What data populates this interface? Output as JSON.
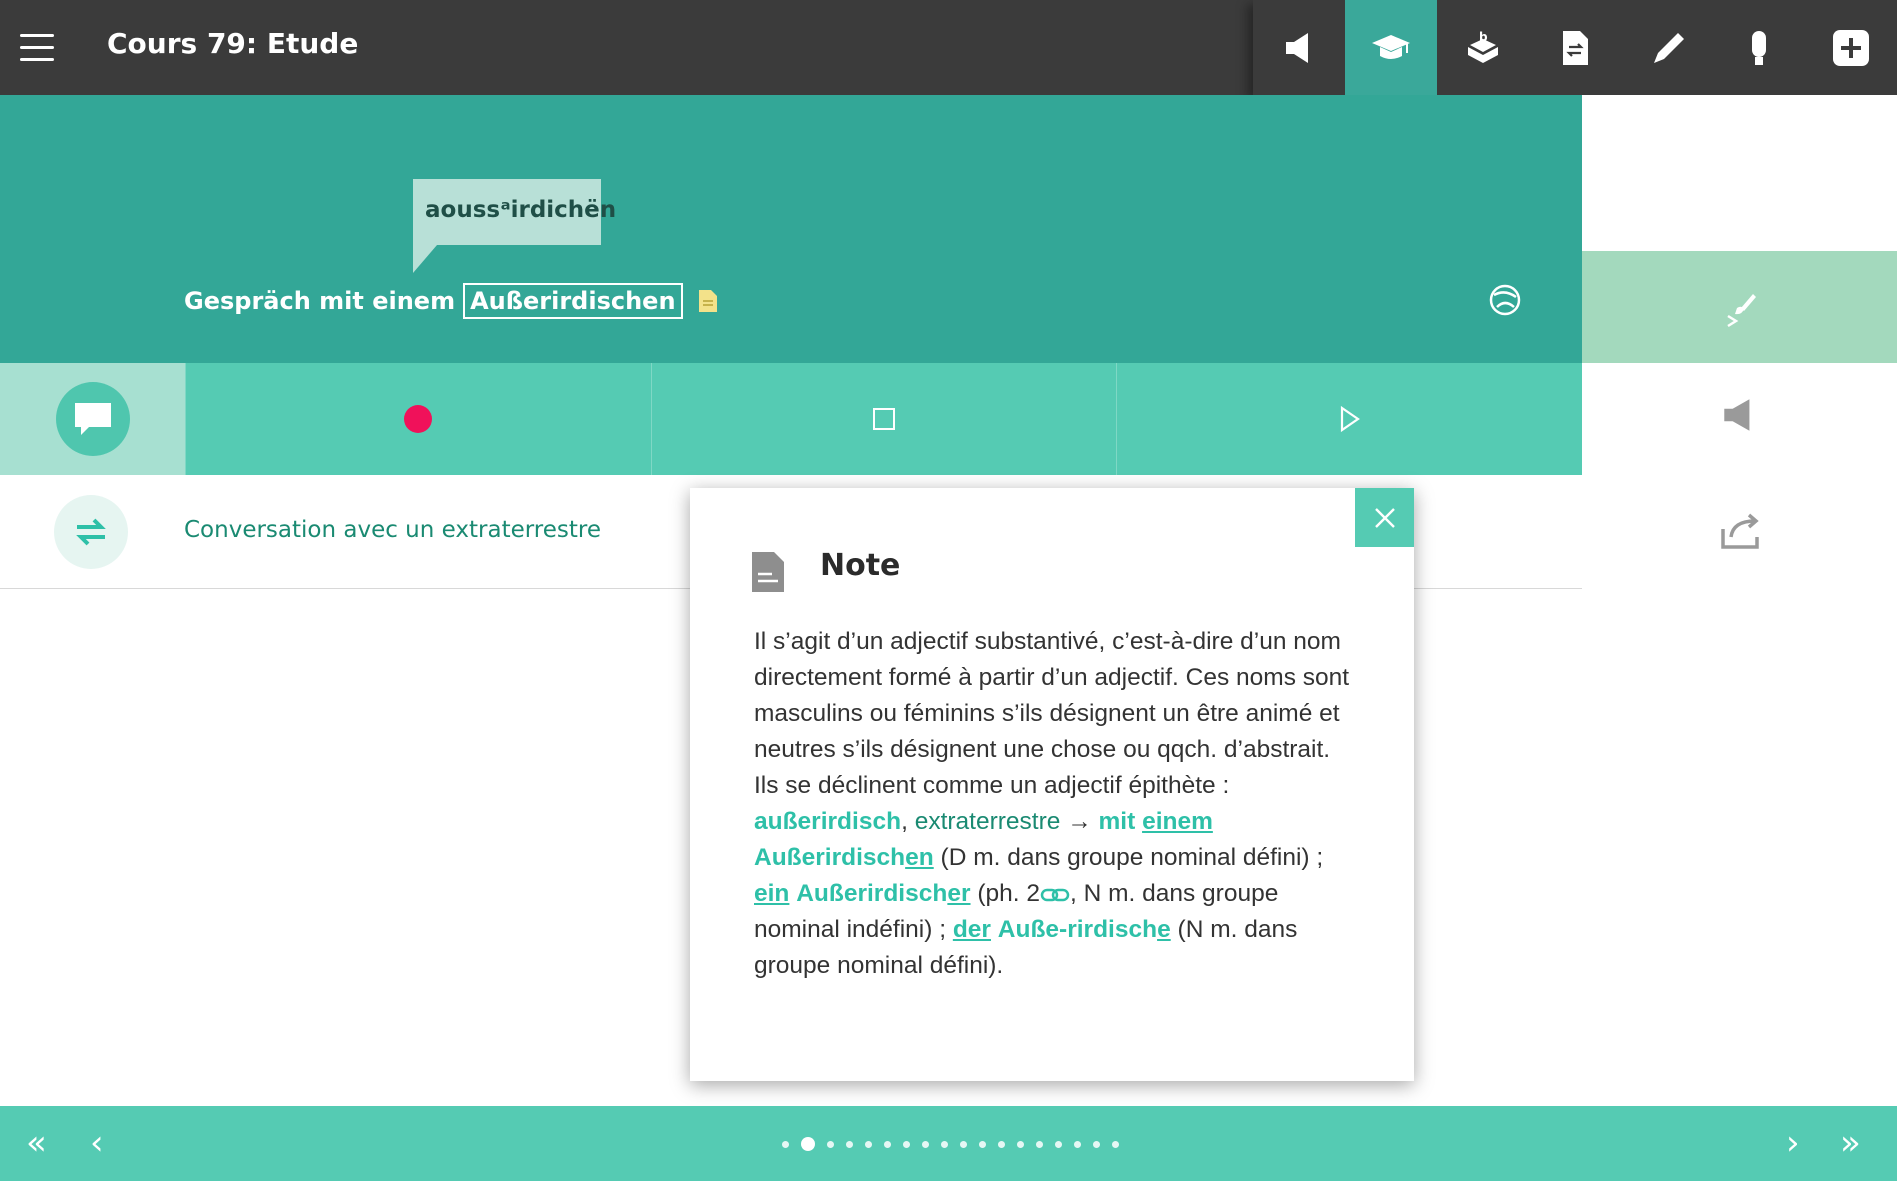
{
  "app": {
    "title": "Cours 79: Etude"
  },
  "toolbar": {
    "buttons": [
      {
        "name": "speaker-icon",
        "active": false
      },
      {
        "name": "graduation-cap-icon",
        "active": true
      },
      {
        "name": "exercise-box-icon",
        "active": false
      },
      {
        "name": "document-translate-icon",
        "active": false
      },
      {
        "name": "pen-icon",
        "active": false
      },
      {
        "name": "microphone-icon",
        "active": false
      },
      {
        "name": "plus-icon",
        "active": false
      }
    ]
  },
  "lesson": {
    "tooltip_phonetic": "aoussᵃirdichën",
    "sentence_prefix": "Gespräch mit einem",
    "sentence_word": "Außerirdischen",
    "translation": "Conversation avec un extraterrestre"
  },
  "note": {
    "title": "Note",
    "p1": "Il s’agit d’un adjectif substantivé, c’est-à-dire d’un nom directement formé à partir d’un adjectif. Ces noms sont masculins ou féminins s’ils désignent un être animé et neutres s’ils désignent une chose ou qqch. d’abstrait. Ils se déclinent comme un adjectif épithète :",
    "w_ausserirdisch": "außerirdisch",
    "comma1": ",",
    "fr_extraterrestre": "extraterrestre",
    "arrow": "→",
    "w_mit": "mit",
    "w_einem": "einem",
    "w_aussen_stem": "Außerirdisch",
    "w_en": "en",
    "t_dm": "(D m. dans groupe nominal défini) ;",
    "w_ein": "ein",
    "w_ausser_stem": "Außerirdisch",
    "w_er": "er",
    "t_ph": "(ph. 2",
    "t_nm": ", N m. dans groupe nominal indéfini) ;",
    "w_der": "der",
    "w_ausse": "Auße-rirdisch",
    "w_e": "e",
    "t_end": "(N m. dans groupe nominal défini)."
  },
  "nav": {
    "first_label": "«",
    "prev_label": "‹",
    "next_label": "›",
    "last_label": "»",
    "page_count": 18,
    "current_page": 2
  },
  "colors": {
    "topbar": "#3b3b3b",
    "teal_dark": "#33a797",
    "teal_light": "#55cbb3",
    "record_red": "#f0115a",
    "check_green": "#a3d9bd"
  }
}
